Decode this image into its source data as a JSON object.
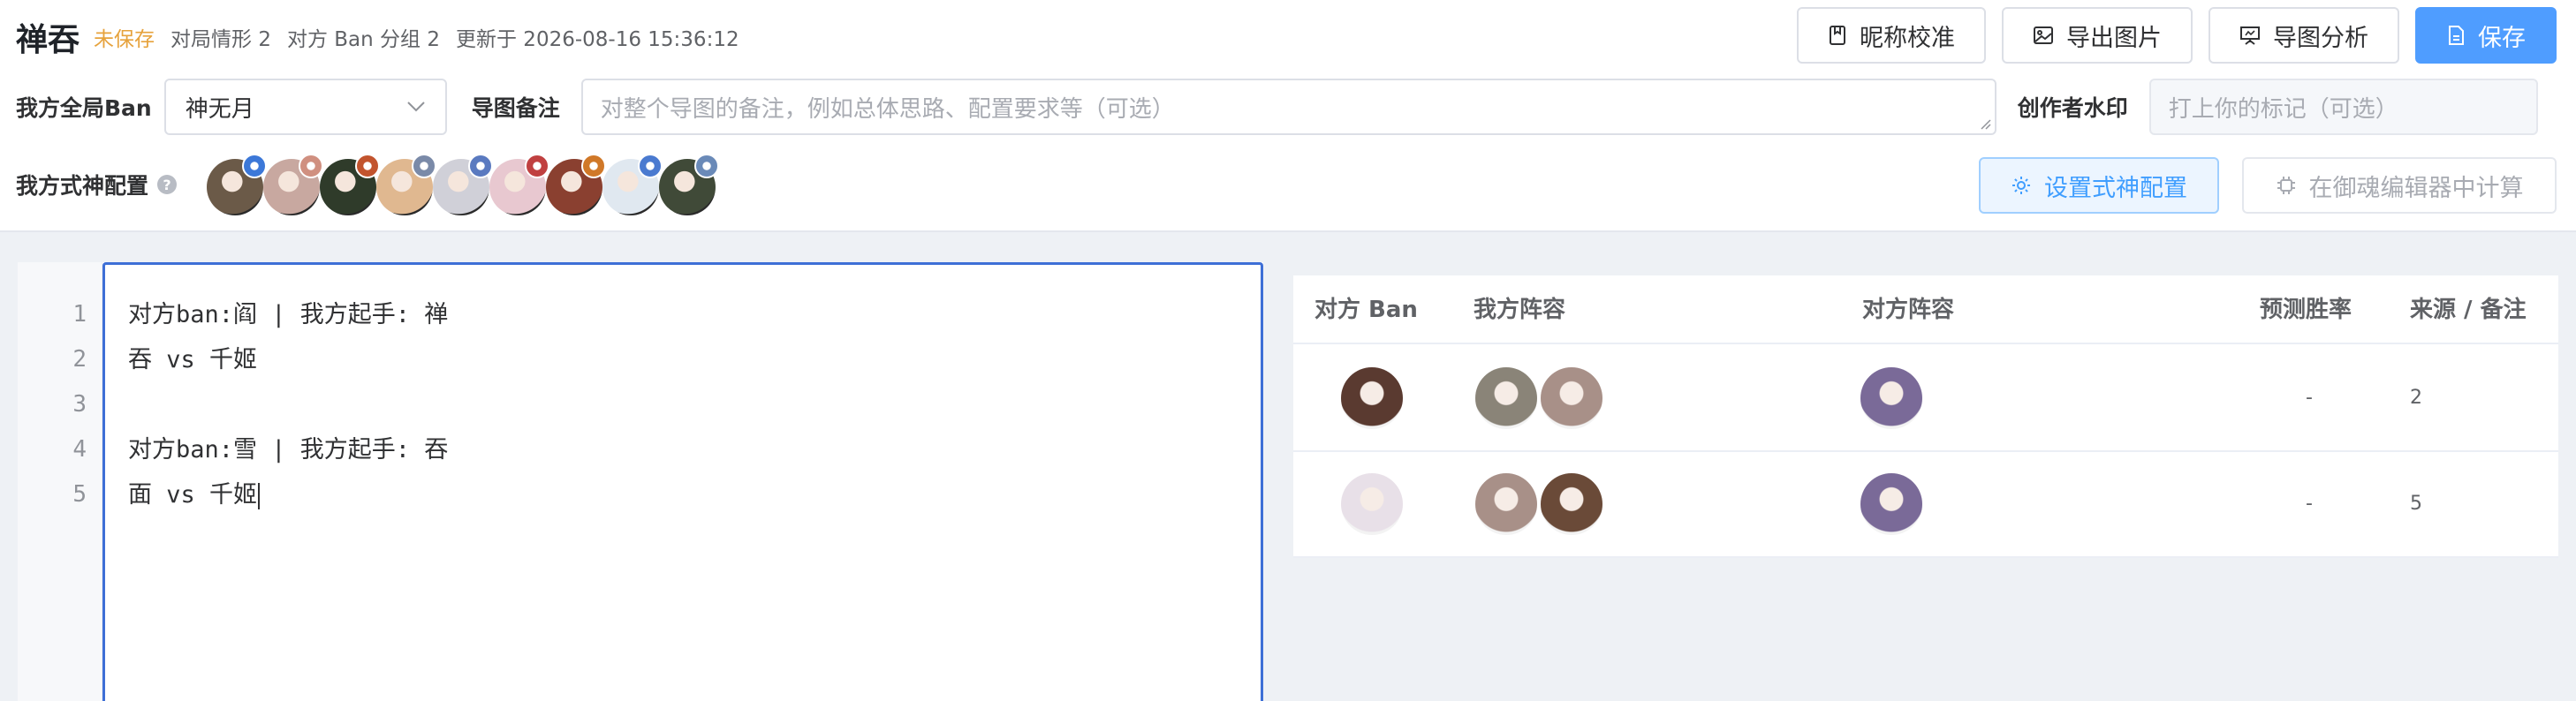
{
  "header": {
    "title": "禅吞",
    "unsaved": "未保存",
    "situation": "对局情形 2",
    "ban_group": "对方 Ban 分组 2",
    "updated": "更新于 2026-08-16 15:36:12"
  },
  "toolbar": {
    "nickname_check": "昵称校准",
    "export_image": "导出图片",
    "map_analysis": "导图分析",
    "save": "保存"
  },
  "settings": {
    "global_ban_label": "我方全局Ban",
    "global_ban_value": "神无月",
    "note_label": "导图备注",
    "note_placeholder": "对整个导图的备注，例如总体思路、配置要求等（可选）",
    "watermark_label": "创作者水印",
    "watermark_placeholder": "打上你的标记（可选）",
    "shikigami_label": "我方式神配置",
    "help_icon": "?",
    "set_shikigami_button": "设置式神配置",
    "calc_button": "在御魂编辑器中计算"
  },
  "shikigami": [
    {
      "face": "#6b5a48",
      "badge": "#3c78d8"
    },
    {
      "face": "#c8a8a0",
      "badge": "#d09080"
    },
    {
      "face": "#2f3b2a",
      "badge": "#c2542e"
    },
    {
      "face": "#e0b890",
      "badge": "#7a8aa8"
    },
    {
      "face": "#d0d0d8",
      "badge": "#5a7ac0"
    },
    {
      "face": "#e8c8d0",
      "badge": "#c04040"
    },
    {
      "face": "#8a4030",
      "badge": "#d07828"
    },
    {
      "face": "#e0e8f0",
      "badge": "#4a7ad0"
    },
    {
      "face": "#404a38",
      "badge": "#6a8ab8"
    }
  ],
  "editor": {
    "line_numbers": [
      "1",
      "2",
      "3",
      "4",
      "5"
    ],
    "lines": [
      "对方ban:阎 | 我方起手: 禅",
      "吞 vs 千姬",
      "",
      "对方ban:雪 | 我方起手: 吞",
      "面 vs 千姬"
    ]
  },
  "table": {
    "headers": {
      "ban": "对方 Ban",
      "ours": "我方阵容",
      "theirs": "对方阵容",
      "win_rate": "预测胜率",
      "source": "来源 / 备注"
    },
    "rows": [
      {
        "ban_color": "#5a3a30",
        "ours_colors": [
          "#8a8478",
          "#a89088"
        ],
        "theirs_color": "#7a6a98",
        "win_rate": "-",
        "source": "2"
      },
      {
        "ban_color": "#e8e0e8",
        "ours_colors": [
          "#a89088",
          "#6a4a38"
        ],
        "theirs_color": "#7a6a98",
        "win_rate": "-",
        "source": "5"
      }
    ]
  },
  "colors": {
    "primary": "#4f9dff",
    "warning": "#e6a23c",
    "editor_border": "#3e6fd6"
  }
}
